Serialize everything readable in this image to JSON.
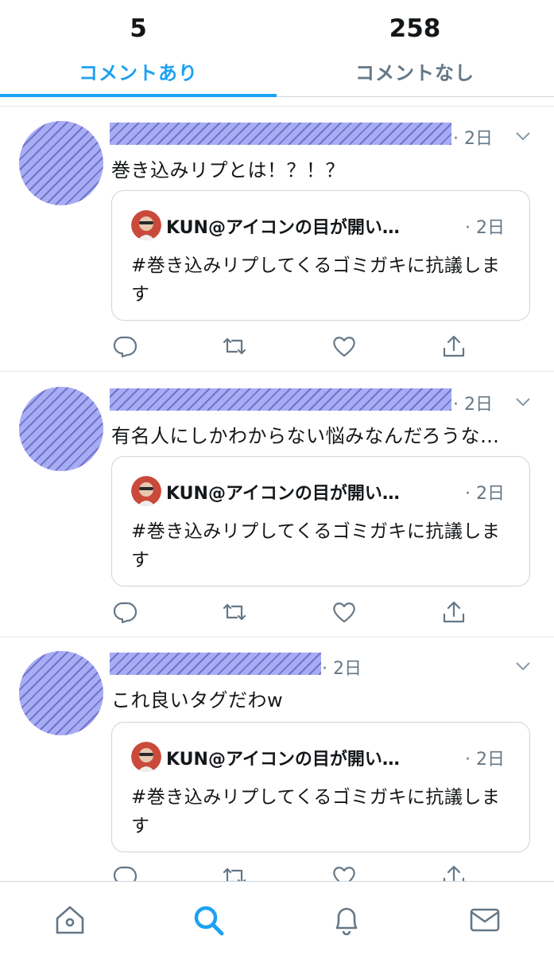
{
  "tabs": [
    {
      "count": "5",
      "label": "コメントあり"
    },
    {
      "count": "258",
      "label": "コメントなし"
    }
  ],
  "tweets": [
    {
      "time": "· 2日",
      "text": "巻き込みリプとは！？！？",
      "quote": {
        "name": "KUN@アイコンの目が開い…",
        "time": "· 2日",
        "text": "#巻き込みリプしてくるゴミガキに抗議します"
      }
    },
    {
      "time": "· 2日",
      "text": "有名人にしかわからない悩みなんだろうな…",
      "quote": {
        "name": "KUN@アイコンの目が開い…",
        "time": "· 2日",
        "text": "#巻き込みリプしてくるゴミガキに抗議します"
      }
    },
    {
      "time": "· 2日",
      "text": "これ良いタグだわw",
      "quote": {
        "name": "KUN@アイコンの目が開い…",
        "time": "· 2日",
        "text": "#巻き込みリプしてくるゴミガキに抗議します"
      }
    }
  ],
  "icons": {
    "reply": "reply-icon",
    "retweet": "retweet-icon",
    "like": "like-icon",
    "share": "share-icon",
    "nav": [
      "home-icon",
      "search-icon",
      "notifications-icon",
      "messages-icon"
    ]
  },
  "colors": {
    "accent": "#1da1f2",
    "muted": "#657786",
    "redaction": "#a8acf4"
  }
}
